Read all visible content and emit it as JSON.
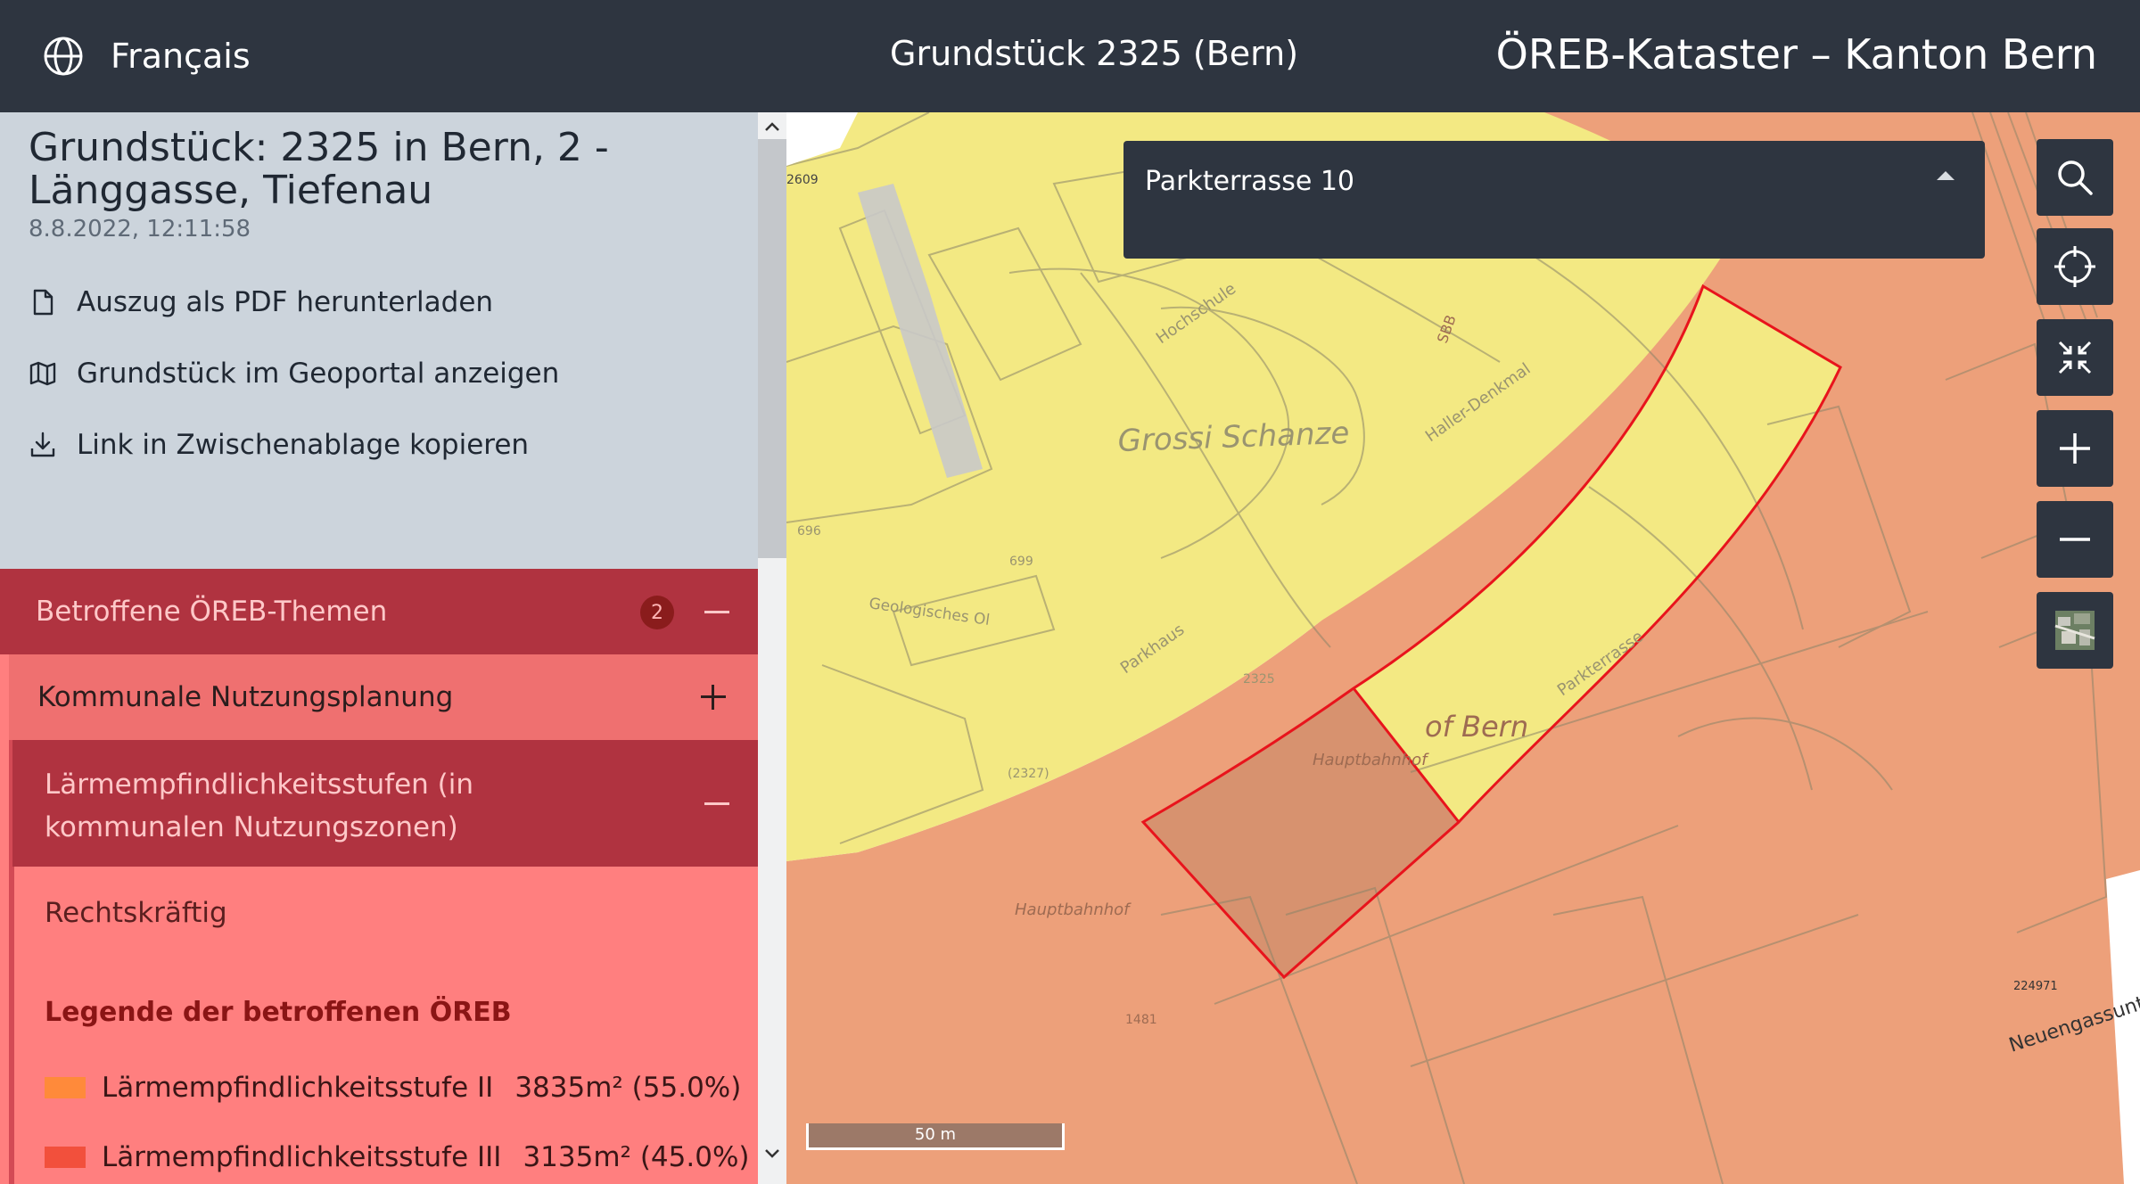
{
  "header": {
    "language": "Français",
    "parcel_title": "Grundstück 2325 (Bern)",
    "app_title": "ÖREB-Kataster – Kanton Bern"
  },
  "parcel": {
    "heading": "Grundstück: 2325 in Bern, 2 - Länggasse, Tiefenau",
    "timestamp": "8.8.2022, 12:11:58",
    "actions": [
      {
        "label": "Auszug als PDF herunterladen",
        "icon": "file-icon"
      },
      {
        "label": "Grundstück im Geoportal anzeigen",
        "icon": "map-icon"
      },
      {
        "label": "Link in Zwischenablage kopieren",
        "icon": "download-icon"
      }
    ]
  },
  "themes": {
    "title": "Betroffene ÖREB-Themen",
    "count": "2",
    "groups": [
      {
        "label": "Kommunale Nutzungsplanung",
        "subgroups": [
          {
            "label": "Lärmempfindlichkeitsstufen (in kommunalen Nutzungszonen)",
            "status": "Rechtskräftig",
            "legend_title": "Legende der betroffenen ÖREB",
            "legend": [
              {
                "name": "Lärmempfindlichkeitsstufe II",
                "value": "3835m² (55.0%)",
                "color": "#ff8a3a"
              },
              {
                "name": "Lärmempfindlichkeitsstufe III",
                "value": "3135m² (45.0%)",
                "color": "#f2503c"
              }
            ]
          }
        ]
      }
    ]
  },
  "map": {
    "search_value": "Parkterrasse 10",
    "scale_label": "50 m",
    "labels": {
      "grossi_schanze": "Grossi Schanze",
      "of_bern": "of Bern",
      "hauptbahnhof_1": "Hauptbahnhof",
      "hauptbahnhof_2": "Hauptbahnhof",
      "parkterrasse": "Parkterrasse",
      "hochschule": "Hochschule",
      "haller": "Haller-Denkmal",
      "parkhaus": "Parkhaus",
      "geologisches": "Geologisches Ol",
      "neuengass": "Neuengassunte",
      "sbb": "SBB",
      "n2609": "2609",
      "n696": "696",
      "n699": "699",
      "n2325": "2325",
      "n2327": "(2327)",
      "n1481": "1481",
      "n224971": "224971"
    },
    "colors": {
      "zone_es2": "#f3e983",
      "zone_es3": "#eda07a",
      "parcel_outline": "#e8141c"
    }
  }
}
